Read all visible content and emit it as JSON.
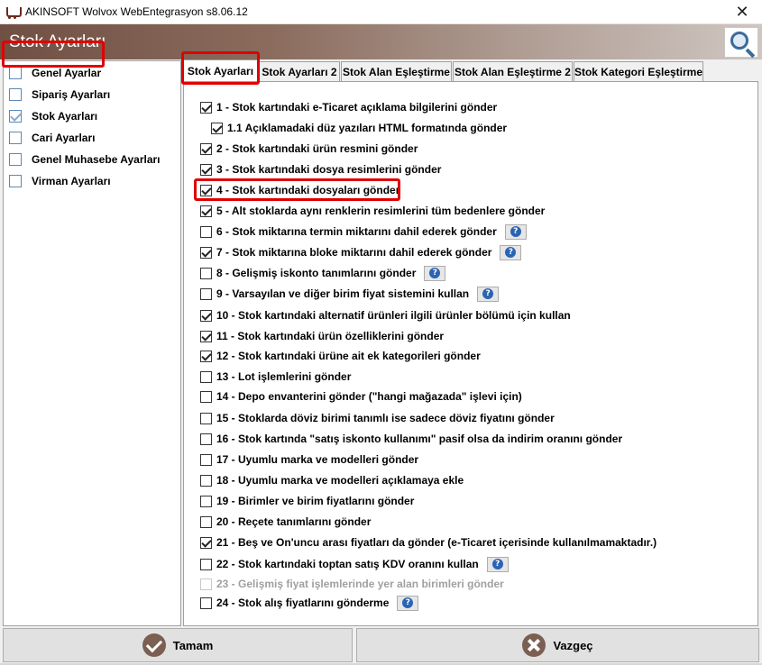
{
  "window": {
    "title": "AKINSOFT Wolvox WebEntegrasyon s8.06.12",
    "close_label": "✕"
  },
  "header": {
    "title": "Stok Ayarları"
  },
  "sidebar": {
    "items": [
      {
        "label": "Genel Ayarlar",
        "checked": false
      },
      {
        "label": "Sipariş Ayarları",
        "checked": false
      },
      {
        "label": "Stok Ayarları",
        "checked": true
      },
      {
        "label": "Cari Ayarları",
        "checked": false
      },
      {
        "label": "Genel Muhasebe Ayarları",
        "checked": false
      },
      {
        "label": "Virman Ayarları",
        "checked": false
      }
    ]
  },
  "tabs": [
    {
      "label": "Stok Ayarları",
      "active": true
    },
    {
      "label": "Stok Ayarları 2",
      "active": false
    },
    {
      "label": "Stok Alan Eşleştirme",
      "active": false
    },
    {
      "label": "Stok Alan Eşleştirme 2",
      "active": false
    },
    {
      "label": "Stok Kategori Eşleştirme",
      "active": false
    }
  ],
  "options": [
    {
      "label": "1 - Stok kartındaki e-Ticaret açıklama bilgilerini gönder",
      "checked": true,
      "help": false,
      "sub": false,
      "disabled": false
    },
    {
      "label": "1.1 Açıklamadaki düz yazıları HTML formatında gönder",
      "checked": true,
      "help": false,
      "sub": true,
      "disabled": false
    },
    {
      "label": "2 - Stok kartındaki ürün resmini gönder",
      "checked": true,
      "help": false,
      "sub": false,
      "disabled": false
    },
    {
      "label": "3 - Stok kartındaki dosya resimlerini gönder",
      "checked": true,
      "help": false,
      "sub": false,
      "disabled": false
    },
    {
      "label": "4 - Stok kartındaki dosyaları gönder",
      "checked": true,
      "help": false,
      "sub": false,
      "disabled": false
    },
    {
      "label": "5 - Alt stoklarda aynı renklerin resimlerini tüm bedenlere gönder",
      "checked": true,
      "help": false,
      "sub": false,
      "disabled": false
    },
    {
      "label": "6 - Stok miktarına termin miktarını dahil ederek gönder",
      "checked": false,
      "help": true,
      "sub": false,
      "disabled": false
    },
    {
      "label": "7 - Stok miktarına bloke miktarını dahil ederek gönder",
      "checked": true,
      "help": true,
      "sub": false,
      "disabled": false
    },
    {
      "label": "8 - Gelişmiş iskonto tanımlarını gönder",
      "checked": false,
      "help": true,
      "sub": false,
      "disabled": false
    },
    {
      "label": "9 - Varsayılan ve diğer birim fiyat sistemini kullan",
      "checked": false,
      "help": true,
      "sub": false,
      "disabled": false
    },
    {
      "label": "10 - Stok kartındaki alternatif ürünleri ilgili ürünler bölümü için kullan",
      "checked": true,
      "help": false,
      "sub": false,
      "disabled": false
    },
    {
      "label": "11 - Stok kartındaki ürün özelliklerini gönder",
      "checked": true,
      "help": false,
      "sub": false,
      "disabled": false
    },
    {
      "label": "12 - Stok kartındaki ürüne ait ek kategorileri gönder",
      "checked": true,
      "help": false,
      "sub": false,
      "disabled": false
    },
    {
      "label": "13 - Lot işlemlerini gönder",
      "checked": false,
      "help": false,
      "sub": false,
      "disabled": false
    },
    {
      "label": "14 - Depo envanterini gönder (\"hangi mağazada\" işlevi için)",
      "checked": false,
      "help": false,
      "sub": false,
      "disabled": false
    },
    {
      "label": "15 - Stoklarda döviz birimi tanımlı ise sadece döviz fiyatını gönder",
      "checked": false,
      "help": false,
      "sub": false,
      "disabled": false
    },
    {
      "label": "16 - Stok kartında \"satış iskonto kullanımı\" pasif olsa da indirim oranını gönder",
      "checked": false,
      "help": false,
      "sub": false,
      "disabled": false
    },
    {
      "label": "17 - Uyumlu marka ve modelleri gönder",
      "checked": false,
      "help": false,
      "sub": false,
      "disabled": false
    },
    {
      "label": "18 - Uyumlu marka ve modelleri açıklamaya ekle",
      "checked": false,
      "help": false,
      "sub": false,
      "disabled": false
    },
    {
      "label": "19 - Birimler ve birim fiyatlarını gönder",
      "checked": false,
      "help": false,
      "sub": false,
      "disabled": false
    },
    {
      "label": "20 - Reçete tanımlarını gönder",
      "checked": false,
      "help": false,
      "sub": false,
      "disabled": false
    },
    {
      "label": "21 - Beş ve On'uncu arası fiyatları da gönder (e-Ticaret içerisinde kullanılmamaktadır.)",
      "checked": true,
      "help": false,
      "sub": false,
      "disabled": false
    },
    {
      "label": "22 - Stok kartındaki toptan satış KDV oranını kullan",
      "checked": false,
      "help": true,
      "sub": false,
      "disabled": false
    },
    {
      "label": "23 - Gelişmiş fiyat işlemlerinde yer alan birimleri gönder",
      "checked": false,
      "help": false,
      "sub": false,
      "disabled": true
    },
    {
      "label": "24 - Stok alış fiyatlarını gönderme",
      "checked": false,
      "help": true,
      "sub": false,
      "disabled": false
    }
  ],
  "help_glyph": "?",
  "buttons": {
    "ok_label": "Tamam",
    "cancel_label": "Vazgeç"
  },
  "colors": {
    "highlight": "#e00000",
    "header_start": "#705043",
    "button_icon": "#7a5f52"
  },
  "icons": {
    "search": "magnifier-icon",
    "ok": "check-circle-icon",
    "cancel": "x-circle-icon"
  }
}
